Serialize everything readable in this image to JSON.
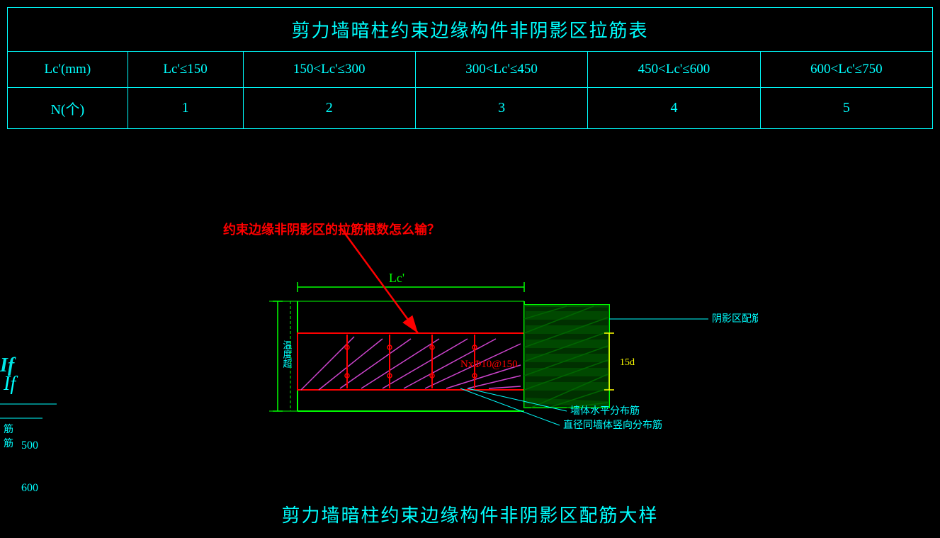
{
  "title": "剪力墙暗柱约束边缘构件非阴影区拉筋表",
  "table": {
    "header": {
      "col0": "Lc'(mm)",
      "col1": "Lc'≤150",
      "col2": "150<Lc'≤300",
      "col3": "300<Lc'≤450",
      "col4": "450<Lc'≤600",
      "col5": "600<Lc'≤750"
    },
    "row": {
      "col0": "N(个)",
      "col1": "1",
      "col2": "2",
      "col3": "3",
      "col4": "4",
      "col5": "5"
    }
  },
  "question": "约束边缘非阴影区的拉筋根数怎么输？",
  "lc_label": "Lc'",
  "nx_label": "NxΦ10@150",
  "label_qiangti": "墙体水平分布筋",
  "label_zhijing": "直径同墙体竖向分布筋",
  "label_wenduchao": "温度超",
  "label_15d": "15d",
  "label_yinying": "阴影区配筋详见相应边缘构件大样",
  "bottom_title": "剪力墙暗柱约束边缘构件非阴影区配筋大样",
  "ruler_500": "500",
  "ruler_600": "600",
  "left_partial": "If"
}
